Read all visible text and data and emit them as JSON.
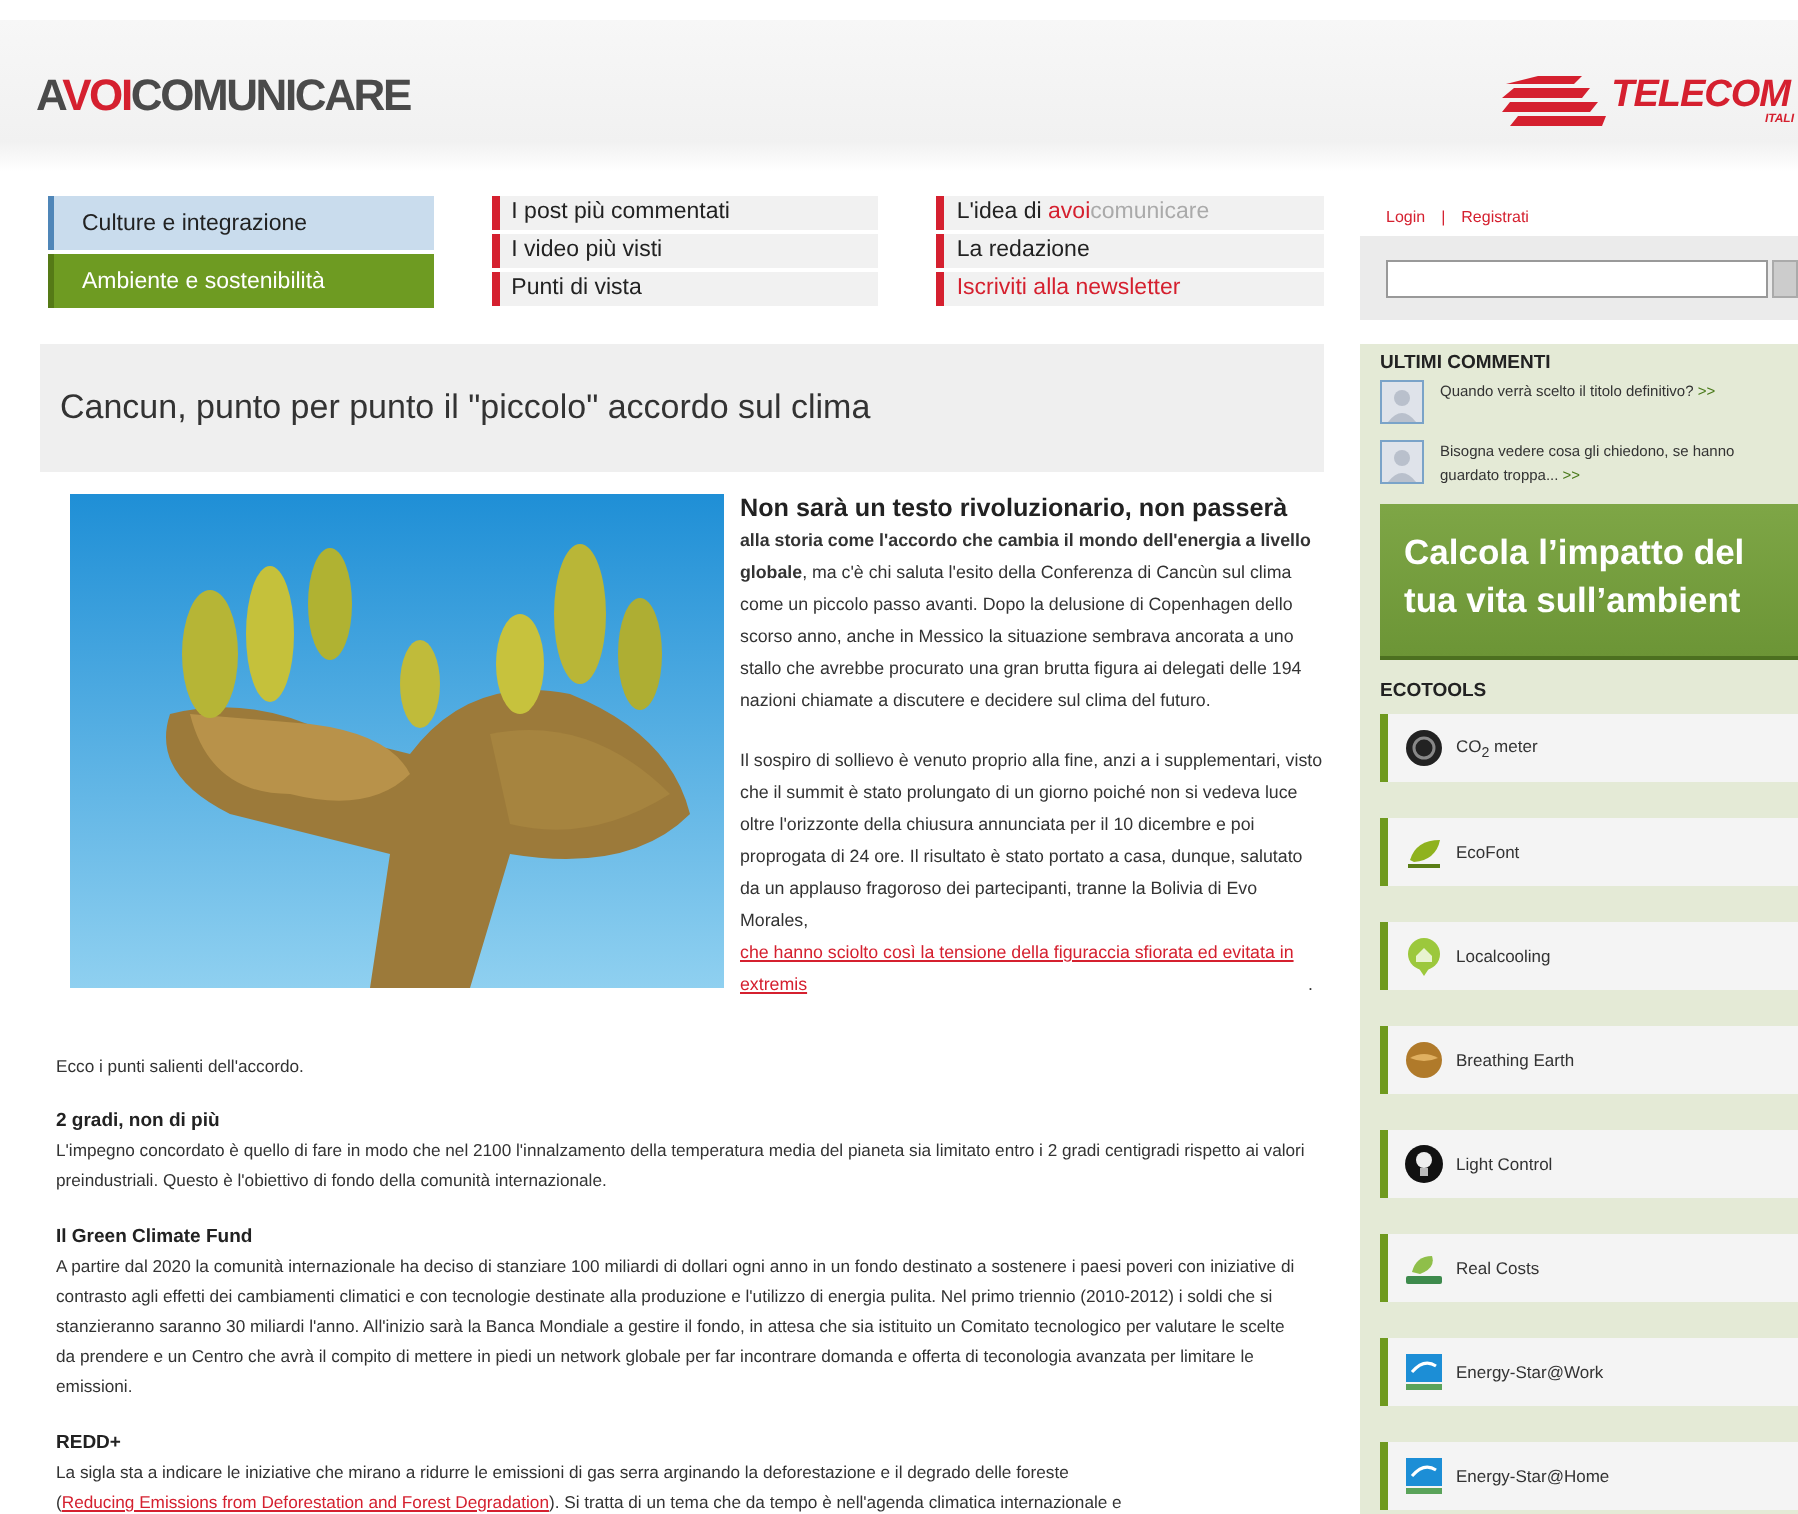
{
  "header": {
    "logo": [
      {
        "text": "A",
        "accent": false
      },
      {
        "text": "VOI",
        "accent": true
      },
      {
        "text": "COMUNICARE",
        "accent": false
      }
    ],
    "partner_logo": {
      "name": "TELECOM",
      "sub": "ITALI"
    }
  },
  "nav": {
    "sections": [
      {
        "kind": "category",
        "items": [
          {
            "label": "Culture e integrazione",
            "selected": false
          },
          {
            "label": "Ambiente e sostenibilità",
            "selected": true
          }
        ]
      },
      {
        "kind": "links",
        "items": [
          {
            "label": "I post più commentati",
            "highlight": false
          },
          {
            "label": "I video più visti",
            "highlight": false
          },
          {
            "label": "Punti di vista",
            "highlight": false
          }
        ]
      },
      {
        "kind": "links",
        "items": [
          {
            "label": [
              {
                "text": "L'idea di ",
                "kind": "plain"
              },
              {
                "text": "avoi",
                "kind": "accent"
              },
              {
                "text": "comunicare",
                "kind": "muted"
              }
            ],
            "highlight": false
          },
          {
            "label": "La redazione",
            "highlight": false
          },
          {
            "label": "Iscriviti alla newsletter",
            "highlight": true
          }
        ]
      }
    ]
  },
  "account": {
    "links": [
      "Login",
      "Registrati"
    ],
    "separator": "|"
  },
  "article": {
    "title": "Cancun, punto per punto il \"piccolo\" accordo sul clima",
    "lead": "Non sarà un testo rivoluzionario, non passerà",
    "intro": "**alla storia come l'accordo che cambia il mondo dell'energia a livello globale**, ma c'è chi saluta l'esito della Conferenza di Cancùn sul clima come un piccolo passo avanti. Dopo la delusione di Copenhagen dello scorso anno, anche in Messico la situazione sembrava ancorata a uno stallo che avrebbe procurato una gran brutta figura ai delegati delle 194 nazioni chiamate a discutere e decidere sul clima del futuro.",
    "paragraph": {
      "before": "Il sospiro di sollievo è venuto proprio alla fine, anzi a i supplementari, visto che il summit è stato prolungato di un giorno poiché non si vedeva luce oltre l'orizzonte della chiusura annunciata per il 10 dicembre e poi proprogata di 24 ore. Il risultato è stato portato a casa, dunque, salutato da un applauso fragoroso dei partecipanti, tranne la Bolivia di Evo Morales, ",
      "link": "che hanno sciolto così la tensione della figuraccia sfiorata ed evitata in extremis",
      "after": "."
    },
    "summary": "Ecco i punti salienti dell'accordo.",
    "sections": [
      {
        "heading": "2 gradi, non di più",
        "before": "L'impegno concordato è quello di fare in modo che nel 2100 l'innalzamento della temperatura media del pianeta sia limitato entro i 2 gradi centigradi rispetto ai valori preindustriali. Questo è l'obiettivo di fondo della comunità internazionale."
      },
      {
        "heading": "Il Green Climate Fund",
        "before": "A partire dal 2020 la comunità internazionale ha deciso di stanziare 100 miliardi di dollari ogni anno in un fondo destinato a sostenere i paesi poveri con iniziative di contrasto agli effetti dei cambiamenti climatici e con tecnologie destinate alla produzione e l'utilizzo di energia pulita. Nel primo triennio (2010-2012) i soldi che si stanzieranno saranno 30 miliardi l'anno. All'inizio sarà la Banca Mondiale a gestire il fondo, in attesa che sia istituito un Comitato tecnologico per valutare le scelte da prendere e un Centro che avrà il compito di mettere in piedi un network globale per far incontrare domanda e offerta di teconologia avanzata per limitare le emissioni."
      },
      {
        "heading": "REDD+",
        "before": "La sigla sta a indicare le iniziative che mirano a ridurre le emissioni di gas serra arginando la deforestazione e il degrado delle foreste (",
        "link": "Reducing Emissions from Deforestation and Forest Degradation",
        "after": "). Si tratta di un tema che da tempo è nell'agenda climatica internazionale e"
      }
    ]
  },
  "sidebar": {
    "comments_title": "ULTIMI COMMENTI",
    "comments": [
      {
        "text": "Quando verrà scelto il titolo definitivo?",
        "more": ">>"
      },
      {
        "text": "Bisogna vedere cosa gli chiedono, se hanno guardato troppa...",
        "more": ">>"
      }
    ],
    "banner": [
      "Calcola l’impatto del",
      "tua vita sull’ambient"
    ],
    "tools_title": "ECOTOOLS",
    "tools": [
      {
        "label": "CO$_{2}$ meter",
        "kind": "co2"
      },
      {
        "label": "EcoFont",
        "kind": "eco"
      },
      {
        "label": "Localcooling",
        "kind": "cooling"
      },
      {
        "label": "Breathing Earth",
        "kind": "earth"
      },
      {
        "label": "Light Control",
        "kind": "bulb"
      },
      {
        "label": "Real Costs",
        "kind": "costs"
      },
      {
        "label": "Energy-Star@Work",
        "kind": "star"
      },
      {
        "label": "Energy-Star@Home",
        "kind": "star"
      }
    ]
  }
}
